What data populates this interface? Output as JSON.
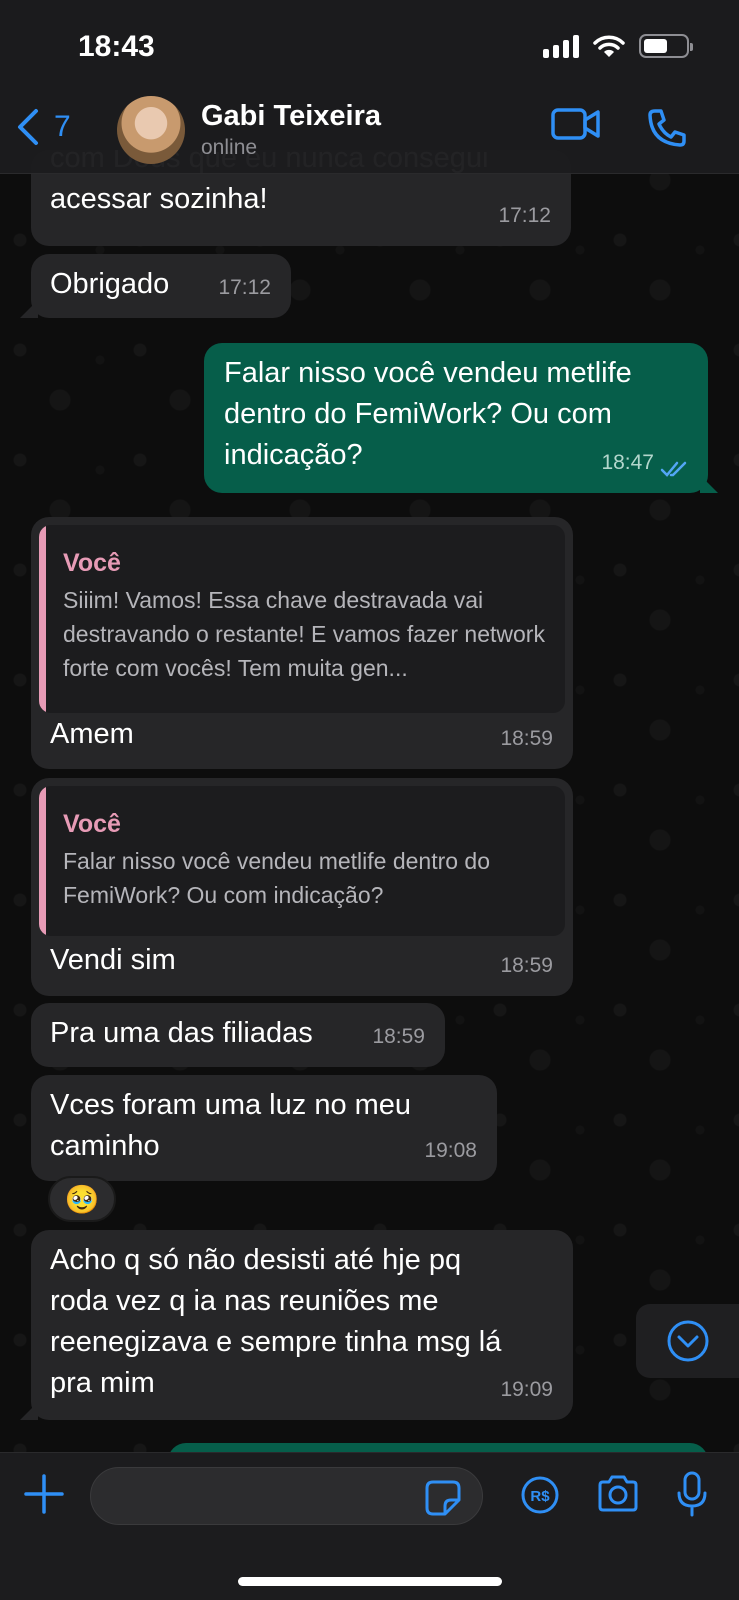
{
  "status_bar": {
    "time": "18:43"
  },
  "header": {
    "back_count": "7",
    "contact_name": "Gabi Teixeira",
    "contact_status": "online"
  },
  "messages": [
    {
      "direction": "in",
      "text": "com Deus que eu nunca consegui\nacessar sozinha!",
      "time": "17:12"
    },
    {
      "direction": "in",
      "text": "Obrigado",
      "time": "17:12"
    },
    {
      "direction": "out",
      "text": "Falar nisso você vendeu metlife\ndentro do FemiWork? Ou com\nindicação?",
      "time": "18:47",
      "read": true
    },
    {
      "direction": "in",
      "quote_author": "Você",
      "quote_text": "Siiim! Vamos! Essa chave destravada vai destravando o restante! E vamos fazer network forte com vocês! Tem muita gen...",
      "text": "Amem",
      "time": "18:59"
    },
    {
      "direction": "in",
      "quote_author": "Você",
      "quote_text": "Falar nisso você vendeu metlife dentro do FemiWork? Ou com indicação?",
      "text": "Vendi sim",
      "time": "18:59"
    },
    {
      "direction": "in",
      "text": "Pra uma das filiadas",
      "time": "18:59"
    },
    {
      "direction": "in",
      "text": "Vces foram uma luz no meu\ncaminho",
      "time": "19:08",
      "reaction": "🥹"
    },
    {
      "direction": "in",
      "text": "Acho q só não desisti até hje pq\nroda vez q ia nas reuniões me\nreenegizava e sempre tinha msg lá\npra mim",
      "time": "19:09"
    }
  ],
  "colors": {
    "accent": "#2f8ff5",
    "incoming_bubble": "#262628",
    "outgoing_bubble": "#065e4a",
    "quote_author": "#e79bb6"
  },
  "icons": {
    "back": "chevron-left-icon",
    "video": "video-camera-icon",
    "call": "phone-icon",
    "add": "plus-icon",
    "sticker": "sticker-icon",
    "payment": "brl-payment-icon",
    "camera": "camera-icon",
    "mic": "microphone-icon",
    "scroll": "chevron-down-circle-icon"
  }
}
